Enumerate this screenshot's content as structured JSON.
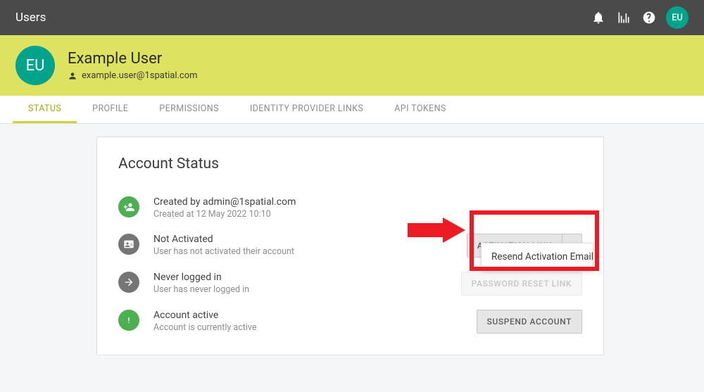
{
  "colors": {
    "teal": "#00a38b",
    "red": "#ed1c24"
  },
  "topbar": {
    "title": "Users",
    "avatar_initials": "EU"
  },
  "banner": {
    "avatar_initials": "EU",
    "name": "Example User",
    "email": "example.user@1spatial.com"
  },
  "tabs": [
    {
      "label": "STATUS",
      "active": true
    },
    {
      "label": "PROFILE"
    },
    {
      "label": "PERMISSIONS"
    },
    {
      "label": "IDENTITY PROVIDER LINKS"
    },
    {
      "label": "API TOKENS"
    }
  ],
  "section": {
    "heading": "Account Status"
  },
  "status": [
    {
      "title": "Created by admin@1spatial.com",
      "subtitle": "Created at 12 May 2022 10:10"
    },
    {
      "title": "Not Activated",
      "subtitle": "User has not activated their account"
    },
    {
      "title": "Never logged in",
      "subtitle": "User has never logged in"
    },
    {
      "title": "Account active",
      "subtitle": "Account is currently active"
    }
  ],
  "buttons": {
    "activation_link": "ACTIVATION LINK",
    "password_reset": "PASSWORD RESET LINK",
    "suspend": "SUSPEND ACCOUNT"
  },
  "dropdown": {
    "items": [
      "Resend Activation Email"
    ]
  }
}
